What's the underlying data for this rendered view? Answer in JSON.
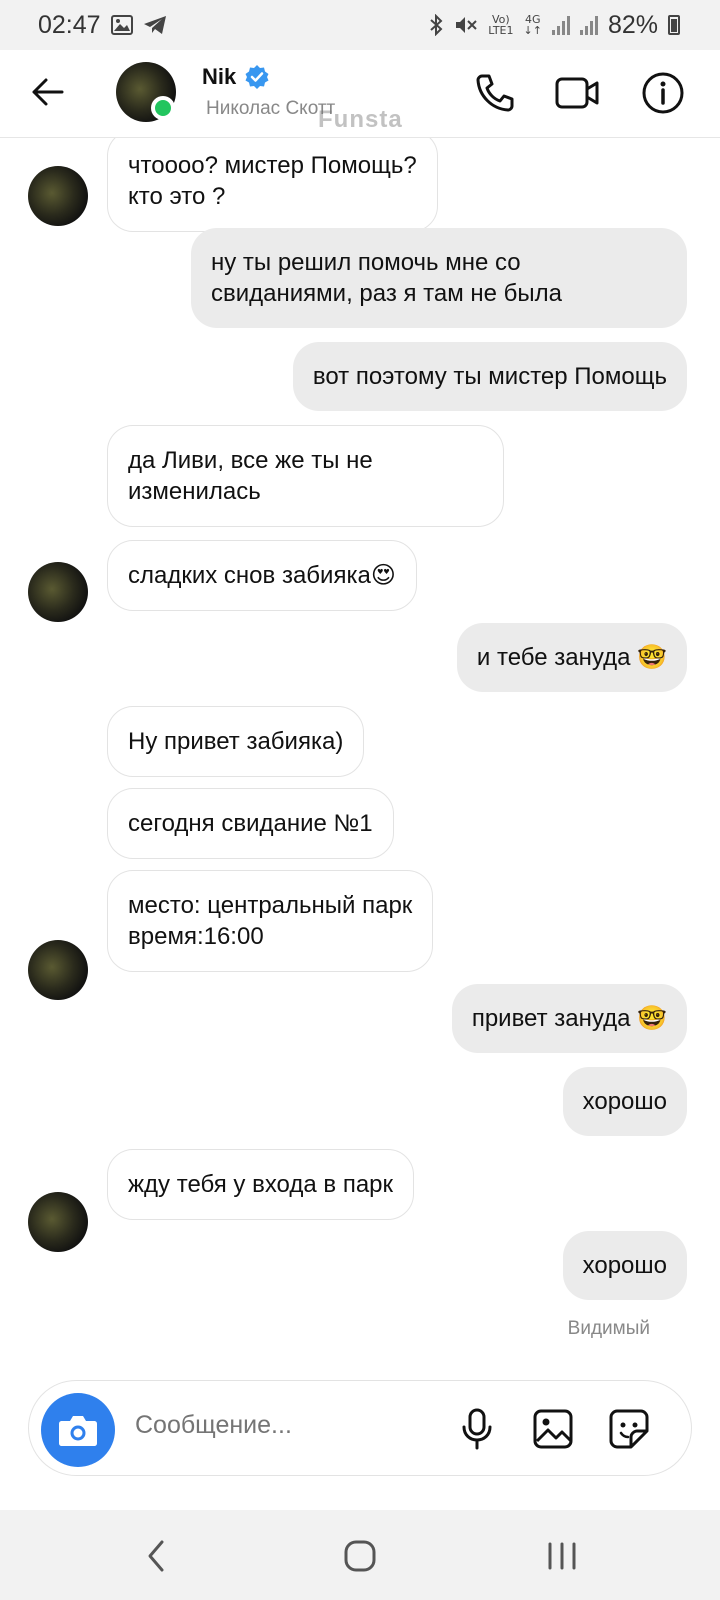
{
  "status_bar": {
    "time": "02:47",
    "network_top": "Vo)",
    "network_bottom": "LTE1",
    "network_type": "4G",
    "battery": "82%"
  },
  "header": {
    "name": "Nik",
    "subtitle": "Николас Скотт",
    "watermark": "Funsta",
    "icons": [
      "back-arrow-icon",
      "verified-badge-icon",
      "phone-icon",
      "video-camera-icon",
      "info-icon"
    ]
  },
  "messages": [
    {
      "side": "in",
      "text": "чтоооо? мистер Помощь?\nкто это ?"
    },
    {
      "side": "out",
      "text": "ну ты решил помочь мне со\nсвиданиями, раз я там не была"
    },
    {
      "side": "out",
      "text": "вот поэтому ты мистер Помощь"
    },
    {
      "side": "in",
      "text": "да Ливи, все же ты не\nизменилась"
    },
    {
      "side": "in",
      "text": "сладких снов забияка",
      "emoji": "😍"
    },
    {
      "side": "out",
      "text": "и тебе зануда ",
      "emoji": "🤓"
    },
    {
      "side": "in",
      "text": "Ну привет забияка)"
    },
    {
      "side": "in",
      "text": "сегодня свидание №1"
    },
    {
      "side": "in",
      "text": "место: центральный парк\nвремя:16:00"
    },
    {
      "side": "out",
      "text": "привет зануда ",
      "emoji": "🤓"
    },
    {
      "side": "out",
      "text": "хорошо"
    },
    {
      "side": "in",
      "text": "жду тебя у входа в парк"
    },
    {
      "side": "out",
      "text": "хорошо"
    }
  ],
  "seen_label": "Видимый",
  "composer": {
    "placeholder": "Сообщение...",
    "icons": [
      "camera-icon",
      "microphone-icon",
      "gallery-icon",
      "sticker-icon"
    ]
  },
  "nav_bar": {
    "icons": [
      "back-nav-icon",
      "home-nav-icon",
      "recent-apps-icon"
    ]
  },
  "colors": {
    "accent": "#2f80ed",
    "online": "#22c55e",
    "outgoing_bubble": "#ebebeb",
    "verified": "#3897f0"
  }
}
